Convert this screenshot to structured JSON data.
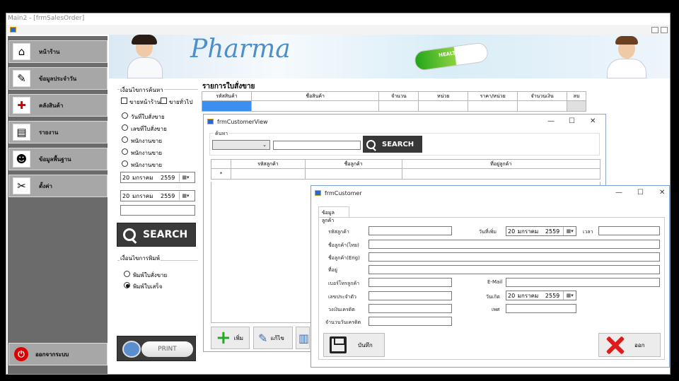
{
  "main_window": {
    "title": "Main2 - [frmSalesOrder]"
  },
  "sidebar": {
    "items": [
      {
        "label": "หน้าร้าน",
        "icon": "house-icon"
      },
      {
        "label": "ข้อมูลประจำวัน",
        "icon": "edit-document-icon"
      },
      {
        "label": "คลังสินค้า",
        "icon": "first-aid-kit-icon"
      },
      {
        "label": "รายงาน",
        "icon": "report-icon"
      },
      {
        "label": "ข้อมูลพื้นฐาน",
        "icon": "user-icon"
      },
      {
        "label": "ตั้งค่า",
        "icon": "tools-icon"
      }
    ],
    "logout": "ออกจากระบบ"
  },
  "banner": {
    "logo": "Pharma",
    "pill_text": "HEALTH care"
  },
  "filter": {
    "group_label": "เงื่อนไขการค้นหา",
    "check1": "ขายหน้าร้าน",
    "check2": "ขายทั่วไป",
    "radios": [
      "วันที่ใบสั่งขาย",
      "เลขที่ใบสั่งขาย",
      "พนักงานขาย",
      "พนักงานขาย",
      "พนักงานขาย"
    ],
    "date1": {
      "day": "20",
      "month": "มกราคม",
      "year": "2559"
    },
    "date2": {
      "day": "20",
      "month": "มกราคม",
      "year": "2559"
    },
    "search_label": "SEARCH"
  },
  "print_group": {
    "label": "เงื่อนไขการพิมพ์",
    "option1": "พิมพ์ใบสั่งขาย",
    "option2": "พิมพ์ใบเสร็จ",
    "selected": "พิมพ์ใบเสร็จ",
    "print_label": "PRINT"
  },
  "order": {
    "title": "รายการใบสั่งขาย",
    "columns": [
      "รหัสสินค้า",
      "ชื่อสินค้า",
      "จำนวน",
      "หน่วย",
      "ราคา/หน่วย",
      "จำนวนเงิน",
      "ลบ"
    ]
  },
  "customer_view": {
    "title": "frmCustomerView",
    "search_group": "ค้นหา",
    "search_label": "SEARCH",
    "columns": [
      "รหัสลูกค้า",
      "ชื่อลูกค้า",
      "ที่อยู่ลูกค้า"
    ],
    "row_marker": "*",
    "add_label": "เพิ่ม",
    "edit_label": "แก้ไข"
  },
  "customer_form": {
    "title": "frmCustomer",
    "tab": "ข้อมูลลูกค้า",
    "labels": {
      "code": "รหัสลูกค้า",
      "name_th": "ชื่อลูกค้า(ไทย)",
      "name_en": "ชื่อลูกค้า(Eng)",
      "address": "ที่อยู่",
      "phone": "เบอร์โทรลูกค้า",
      "id_card": "เลขประจำตัว",
      "credit_limit": "วงเงินเครดิต",
      "credit_days": "จำนวนวันเครดิต",
      "added_date": "วันที่เพิ่ม",
      "time": "เวลา",
      "email": "E-Mail",
      "birthday": "วันเกิด",
      "gender": "เพศ"
    },
    "added_date": {
      "day": "20",
      "month": "มกราคม",
      "year": "2559"
    },
    "birthday": {
      "day": "20",
      "month": "มกราคม",
      "year": "2559"
    },
    "save_label": "บันทึก",
    "exit_label": "ออก"
  },
  "colors": {
    "sidebar": "#6b6b6b",
    "menu_button": "#a7a7a7",
    "search_button": "#3a3a3a",
    "exit_red": "#e01b1b",
    "window_border": "#8fa7c6"
  }
}
